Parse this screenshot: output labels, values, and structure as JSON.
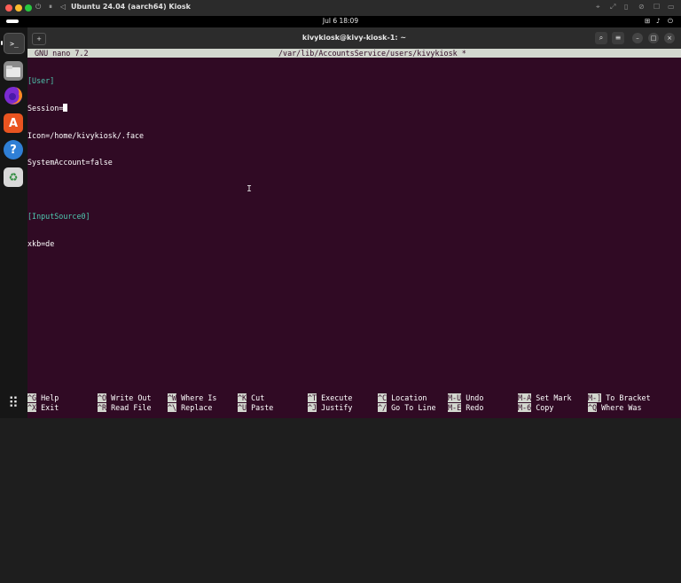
{
  "vm": {
    "title": "Ubuntu 24.04 (aarch64) Kiosk",
    "controls": [
      "⏻",
      "⏸",
      "◁"
    ],
    "right_icons": [
      "⌖",
      "⤢",
      "▯",
      "⊘",
      "☐",
      "▭"
    ]
  },
  "topbar": {
    "datetime": "Jul 6  18:09",
    "tray": [
      "⊞",
      "♪",
      "⏻"
    ]
  },
  "dock": {
    "apps": [
      "Terminal",
      "Files",
      "Firefox",
      "App Center",
      "Help",
      "Trash"
    ]
  },
  "terminal": {
    "title": "kivykiosk@kivy-kiosk-1: ~",
    "newtab_icon": "new-tab-icon",
    "search_icon": "search-icon",
    "menu_icon": "menu-icon"
  },
  "nano": {
    "version": "GNU nano 7.2",
    "filename": "/var/lib/AccountsService/users/kivykiosk *",
    "lines": [
      {
        "text": "[User]",
        "type": "section"
      },
      {
        "text": "Session=",
        "type": "cursor"
      },
      {
        "text": "Icon=/home/kivykiosk/.face",
        "type": "normal"
      },
      {
        "text": "SystemAccount=false",
        "type": "normal"
      },
      {
        "text": "",
        "type": "normal"
      },
      {
        "text": "[InputSource0]",
        "type": "section"
      },
      {
        "text": "xkb=de",
        "type": "normal"
      }
    ],
    "shortcuts": [
      {
        "key": "^G",
        "label": "Help"
      },
      {
        "key": "^O",
        "label": "Write Out"
      },
      {
        "key": "^W",
        "label": "Where Is"
      },
      {
        "key": "^K",
        "label": "Cut"
      },
      {
        "key": "^T",
        "label": "Execute"
      },
      {
        "key": "^C",
        "label": "Location"
      },
      {
        "key": "M-U",
        "label": "Undo"
      },
      {
        "key": "M-A",
        "label": "Set Mark"
      },
      {
        "key": "M-]",
        "label": "To Bracket"
      },
      {
        "key": "^X",
        "label": "Exit"
      },
      {
        "key": "^R",
        "label": "Read File"
      },
      {
        "key": "^\\",
        "label": "Replace"
      },
      {
        "key": "^U",
        "label": "Paste"
      },
      {
        "key": "^J",
        "label": "Justify"
      },
      {
        "key": "^/",
        "label": "Go To Line"
      },
      {
        "key": "M-E",
        "label": "Redo"
      },
      {
        "key": "M-6",
        "label": "Copy"
      },
      {
        "key": "^Q",
        "label": "Where Was"
      }
    ]
  },
  "colors": {
    "terminal_bg": "#300a24",
    "nano_bar_bg": "#d3d7cf",
    "section_text": "#4ec9b0",
    "ubuntu_orange": "#e95420"
  }
}
